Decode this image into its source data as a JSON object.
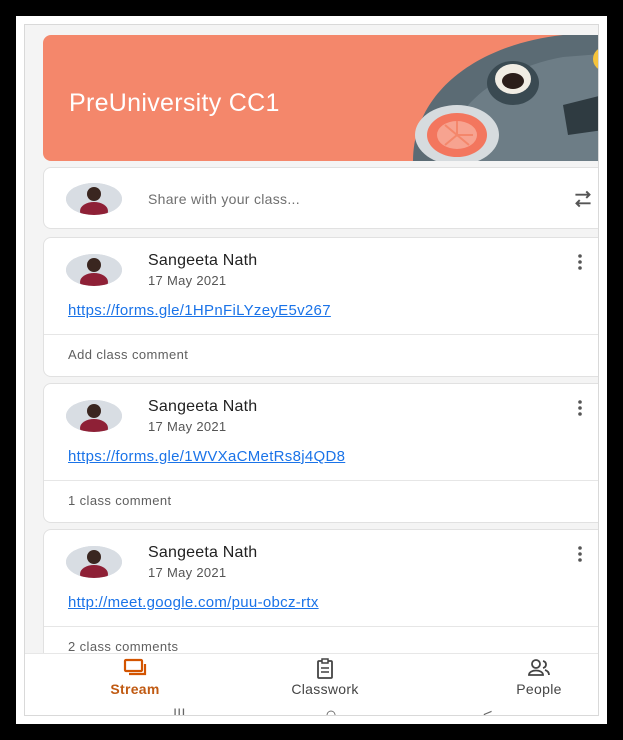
{
  "course": {
    "title": "PreUniversity CC1"
  },
  "share": {
    "placeholder": "Share with your class..."
  },
  "posts": [
    {
      "author": "Sangeeta Nath",
      "date": "17 May 2021",
      "link": "https://forms.gle/1HPnFiLYzeyE5v267",
      "comment": "Add class comment"
    },
    {
      "author": "Sangeeta Nath",
      "date": "17 May 2021",
      "link": "https://forms.gle/1WVXaCMetRs8j4QD8",
      "comment": "1 class comment"
    },
    {
      "author": "Sangeeta Nath",
      "date": "17 May 2021",
      "link": "http://meet.google.com/puu-obcz-rtx",
      "comment": "2 class comments"
    }
  ],
  "nav": {
    "stream": "Stream",
    "classwork": "Classwork",
    "people": "People"
  },
  "system_nav": {
    "recents": "|||",
    "home": "○",
    "back": "<"
  },
  "colors": {
    "banner": "#f4876b",
    "accent": "#d35400",
    "link": "#1a73e8"
  },
  "icons": {
    "share": "repost-icon",
    "menu": "kebab-icon",
    "stream": "stream-icon",
    "classwork": "clipboard-icon",
    "people": "people-icon"
  }
}
